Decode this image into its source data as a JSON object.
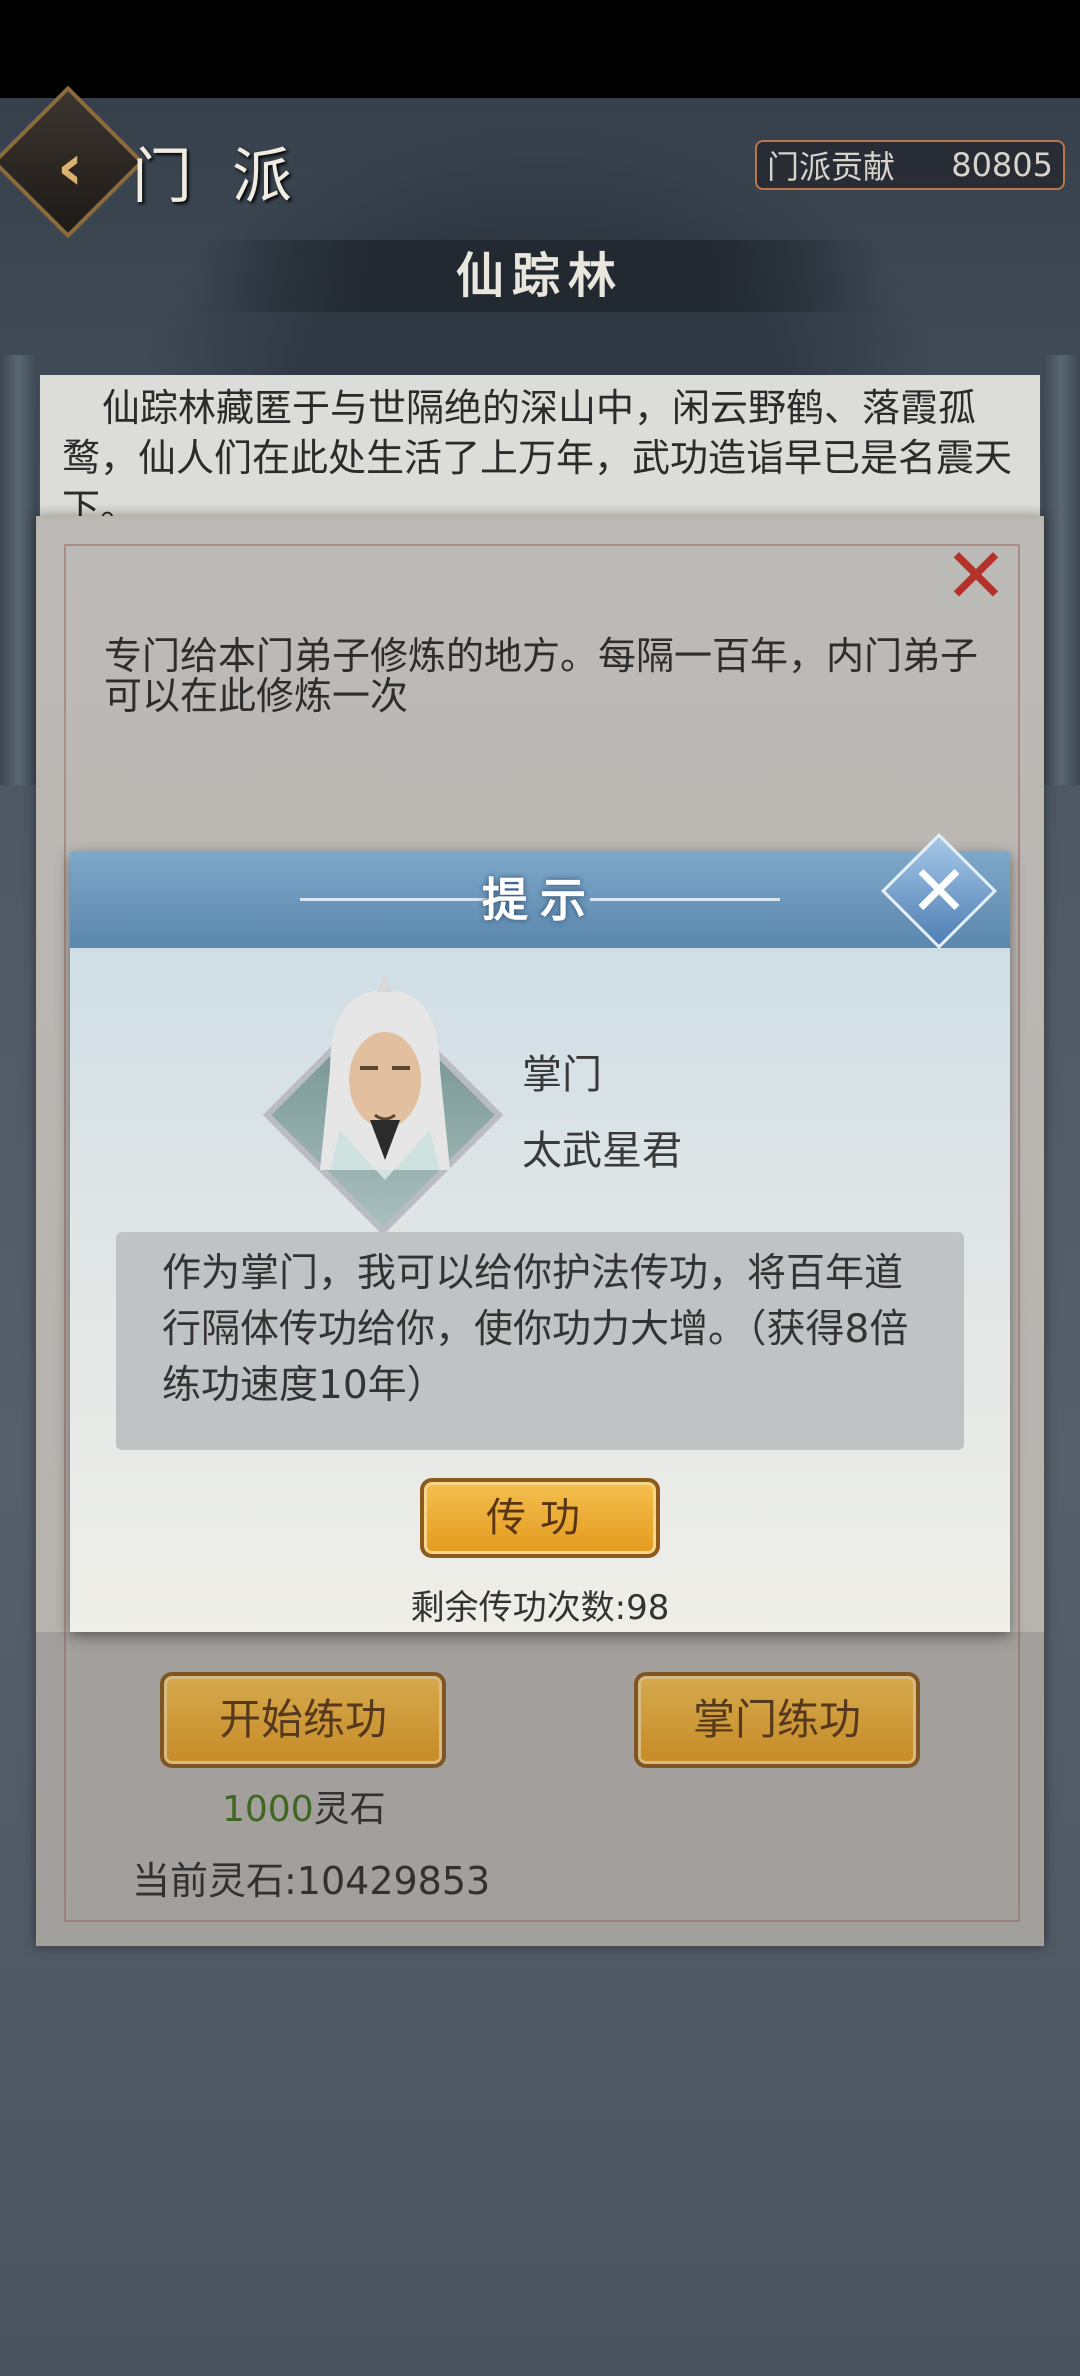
{
  "header": {
    "title": "门派",
    "contribution_label": "门派贡献",
    "contribution_value": "80805"
  },
  "sect": {
    "name": "仙踪林",
    "description": "仙踪林藏匿于与世隔绝的深山中，闲云野鹤、落霞孤鹜，仙人们在此处生活了上万年，武功造诣早已是名震天下。"
  },
  "panel": {
    "description": "专门给本门弟子修炼的地方。每隔一百年，内门弟子可以在此修炼一次",
    "start_button": "开始练功",
    "master_button": "掌门练功",
    "cost_amount": "1000",
    "cost_unit": "灵石",
    "current_stone": "当前灵石:10429853"
  },
  "dialog": {
    "title": "提示",
    "role": "掌门",
    "npc_name": "太武星君",
    "message": "作为掌门，我可以给你护法传功，将百年道行隔体传功给你，使你功力大增。（获得8倍练功速度10年）",
    "action_button": "传功",
    "remaining": "剩余传功次数:98"
  }
}
